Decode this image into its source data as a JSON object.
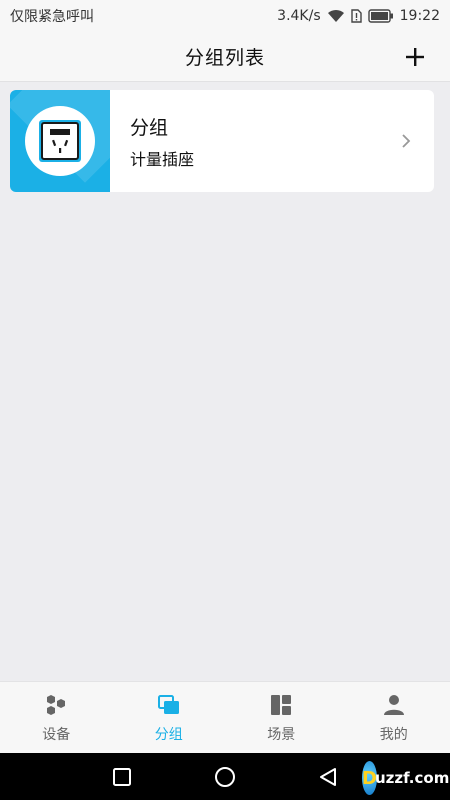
{
  "status_bar": {
    "carrier_text": "仅限紧急呼叫",
    "network_speed": "3.4K/s",
    "time": "19:22"
  },
  "header": {
    "title": "分组列表",
    "add_icon": "plus-icon"
  },
  "groups": [
    {
      "name": "分组",
      "device": "计量插座",
      "icon": "smart-socket-icon"
    }
  ],
  "tabs": [
    {
      "label": "设备",
      "icon": "devices-icon",
      "active": false
    },
    {
      "label": "分组",
      "icon": "groups-icon",
      "active": true
    },
    {
      "label": "场景",
      "icon": "scenes-icon",
      "active": false
    },
    {
      "label": "我的",
      "icon": "profile-icon",
      "active": false
    }
  ],
  "watermark": {
    "logo_text": "uzzf.com"
  },
  "colors": {
    "accent": "#1ab0e6",
    "thumb_bg": "#1bb0e6",
    "page_bg": "#ededf0"
  }
}
